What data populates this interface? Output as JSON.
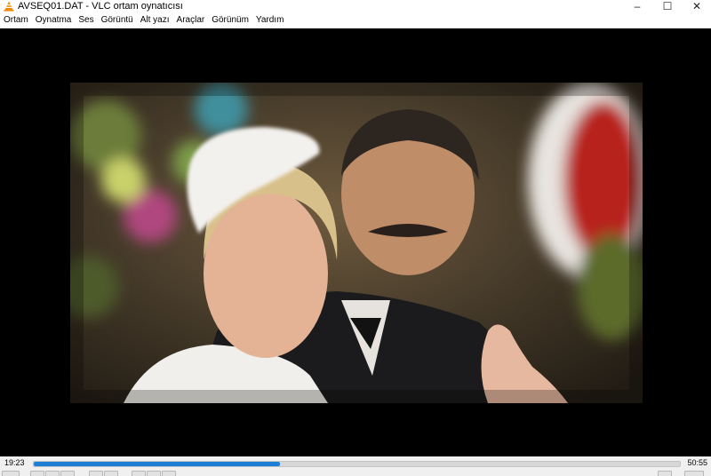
{
  "window": {
    "title": "AVSEQ01.DAT - VLC ortam oynatıcısı",
    "icon": "vlc-cone-icon",
    "minimize": "–",
    "maximize": "☐",
    "close": "✕"
  },
  "menu": [
    {
      "label": "Ortam"
    },
    {
      "label": "Oynatma"
    },
    {
      "label": "Ses"
    },
    {
      "label": "Görüntü"
    },
    {
      "label": "Alt yazı"
    },
    {
      "label": "Araçlar"
    },
    {
      "label": "Görünüm"
    },
    {
      "label": "Yardım"
    }
  ],
  "playback": {
    "elapsed": "19:23",
    "total": "50:55",
    "progress": 0.381
  },
  "colors": {
    "accent": "#1f7fd6",
    "video_bg": "#000000"
  }
}
